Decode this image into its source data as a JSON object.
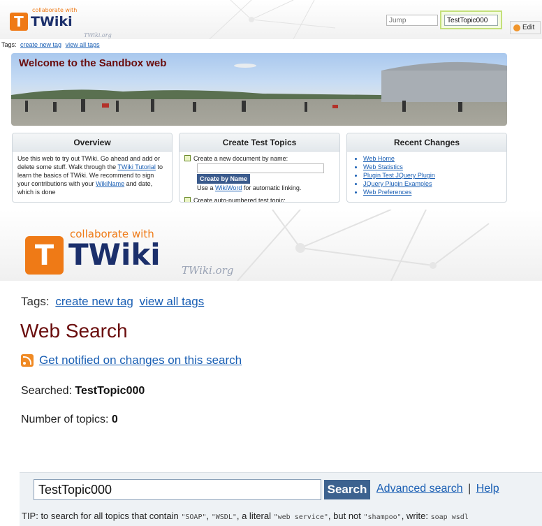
{
  "top": {
    "logo": {
      "collab": "collaborate with",
      "t": "T",
      "word": "TWiki",
      "org": "TWiki.org"
    },
    "jump_placeholder": "Jump",
    "search_value": "TestTopic000",
    "edit_label": "Edit",
    "tags_label": "Tags:",
    "create_tag": "create new tag",
    "view_tags": "view all tags",
    "banner_title": "Welcome to the Sandbox web",
    "overview": {
      "title": "Overview",
      "text1": "Use this web to try out TWiki. Go ahead and add or delete some stuff. Walk through the",
      "link1": "TWiki Tutorial",
      "text2": "to learn the basics of TWiki. We recommend to sign your contributions with your",
      "link2": "WikiName",
      "text3": "and date, which is done"
    },
    "create": {
      "title": "Create Test Topics",
      "label": "Create a new document by name:",
      "button": "Create by Name",
      "hint_pre": "Use a",
      "hint_link": "WikiWord",
      "hint_post": "for automatic linking.",
      "auto": "Create auto-numbered test topic:"
    },
    "recent": {
      "title": "Recent Changes",
      "items": [
        "Web Home",
        "Web Statistics",
        "Plugin Test JQuery Plugin",
        "JQuery Plugin Examples",
        "Web Preferences"
      ]
    }
  },
  "bottom": {
    "logo": {
      "collab": "collaborate with",
      "t": "T",
      "word": "TWiki",
      "org": "TWiki.org"
    },
    "tags_label": "Tags:",
    "create_tag": "create new tag",
    "view_tags": "view all tags",
    "title": "Web Search",
    "notify": "Get notified on changes on this search",
    "searched_label": "Searched:",
    "searched_value": "TestTopic000",
    "num_label": "Number of topics:",
    "num_value": "0",
    "search_value": "TestTopic000",
    "search_button": "Search",
    "advanced": "Advanced search",
    "sep": "|",
    "help": "Help",
    "tip": {
      "t1": "TIP: to search for all topics that contain",
      "c1": "\"SOAP\"",
      "t2": ",",
      "c2": "\"WSDL\"",
      "t3": ", a literal",
      "c3": "\"web service\"",
      "t4": ", but not",
      "c4": "\"shampoo\"",
      "t5": ", write:",
      "c5": "soap wsdl"
    }
  },
  "colors": {
    "accent_orange": "#ef7a16",
    "title_maroon": "#6a0d0d",
    "link_blue": "#1a5fb4",
    "button_blue": "#3c628f"
  }
}
